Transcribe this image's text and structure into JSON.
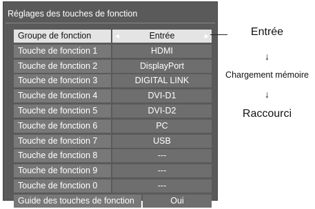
{
  "panel": {
    "title": "Réglages des touches de fonction"
  },
  "rows": [
    {
      "label": "Groupe de fonction",
      "value": "Entrée",
      "selected": true,
      "left_arrow": "◀",
      "right_arrow": "▶"
    },
    {
      "label": "Touche de fonction 1",
      "value": "HDMI"
    },
    {
      "label": "Touche de fonction 2",
      "value": "DisplayPort"
    },
    {
      "label": "Touche de fonction 3",
      "value": "DIGITAL LINK"
    },
    {
      "label": "Touche de fonction 4",
      "value": "DVI-D1"
    },
    {
      "label": "Touche de fonction 5",
      "value": "DVI-D2"
    },
    {
      "label": "Touche de fonction 6",
      "value": "PC"
    },
    {
      "label": "Touche de fonction 7",
      "value": "USB"
    },
    {
      "label": "Touche de fonction 8",
      "value": "---"
    },
    {
      "label": "Touche de fonction 9",
      "value": "---"
    },
    {
      "label": "Touche de fonction 0",
      "value": "---"
    }
  ],
  "guide": {
    "label": "Guide des touches de fonction",
    "value": "Oui"
  },
  "flow": {
    "step1": "Entrée",
    "arrow1": "↓",
    "step2": "Chargement mémoire",
    "arrow2": "↓",
    "step3": "Raccourci"
  }
}
